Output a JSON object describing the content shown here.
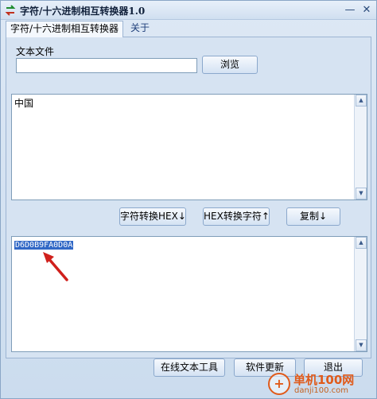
{
  "window": {
    "title": "字符/十六进制相互转换器1.0",
    "minimize_glyph": "—",
    "close_glyph": "✕"
  },
  "tabs": [
    {
      "label": "字符/十六进制相互转换器",
      "active": true
    },
    {
      "label": "关于",
      "active": false
    }
  ],
  "file_group": {
    "label": "文本文件",
    "path_value": "",
    "browse_label": "浏览"
  },
  "input_text": "中国",
  "actions": {
    "to_hex_label": "字符转换HEX↓",
    "hex_to_char_label": "HEX转换字符↑",
    "copy_label": "复制↓"
  },
  "output_text": "D6D0B9FA0D0A",
  "footer": {
    "online_tools_label": "在线文本工具",
    "update_label": "软件更新",
    "exit_label": "退出"
  },
  "watermark": {
    "main": "单机100网",
    "sub": "danji100.com"
  },
  "colors": {
    "selection": "#3168c6",
    "annotation_arrow": "#d0201c",
    "watermark": "#e05a1a"
  }
}
